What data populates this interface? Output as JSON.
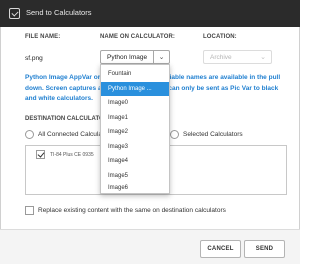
{
  "window": {
    "title": "Send to Calculators"
  },
  "headers": {
    "file_name": "FILE NAME:",
    "name_on_calculator": "NAME ON CALCULATOR:",
    "location": "LOCATION:"
  },
  "file": {
    "name": "sf.png",
    "calculator_name": "Python Image",
    "location": "Archive"
  },
  "info_text": "Python Image AppVar or Image Var. Python variable names are available in the pull down. Screen captures and converted images can only be sent as Pic Var to black and white calculators.",
  "destination": {
    "header": "DESTINATION CALCULATORS:",
    "option_all": "All Connected Calculators",
    "option_selected": "Selected Calculators",
    "calculators": [
      {
        "name": "TI-84 Plus CE 0935",
        "checked": true
      }
    ]
  },
  "replace_label": "Replace existing content with the same on destination calculators",
  "buttons": {
    "cancel": "CANCEL",
    "send": "SEND"
  },
  "dropdown": {
    "items": [
      "Fountain",
      "Python Image ...",
      "Image0",
      "Image1",
      "Image2",
      "Image3",
      "Image4",
      "Image5",
      "Image6"
    ],
    "selected_index": 1
  },
  "colors": {
    "titlebar": "#2b2b2b",
    "accent": "#2a90dd",
    "info_text": "#1f7fd0"
  }
}
